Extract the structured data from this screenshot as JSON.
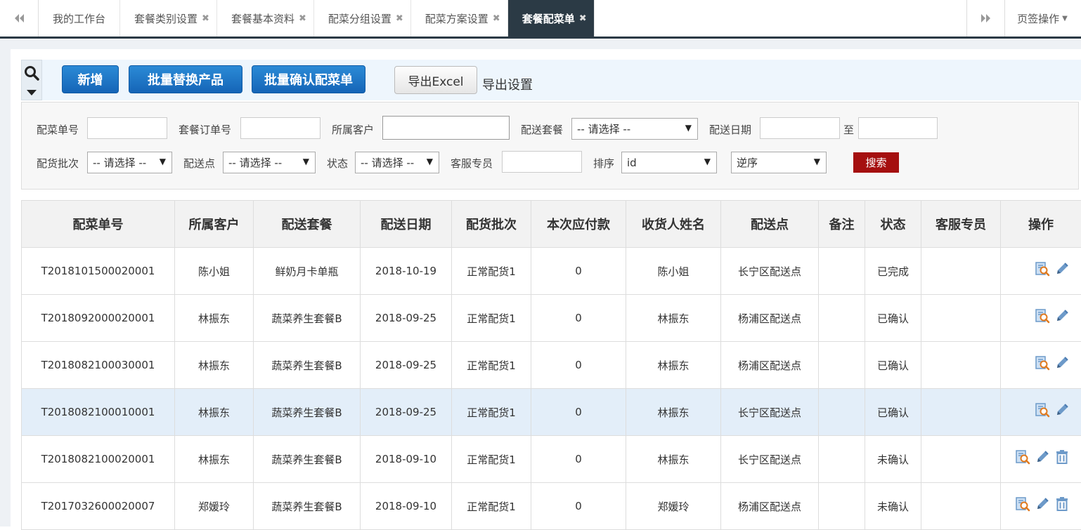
{
  "tabs": {
    "items": [
      {
        "label": "我的工作台",
        "closable": false,
        "active": false
      },
      {
        "label": "套餐类别设置",
        "closable": true,
        "active": false
      },
      {
        "label": "套餐基本资料",
        "closable": true,
        "active": false
      },
      {
        "label": "配菜分组设置",
        "closable": true,
        "active": false
      },
      {
        "label": "配菜方案设置",
        "closable": true,
        "active": false
      },
      {
        "label": "套餐配菜单",
        "closable": true,
        "active": true
      }
    ],
    "page_ops_label": "页签操作"
  },
  "toolbar": {
    "add_label": "新增",
    "batch_replace_label": "批量替换产品",
    "batch_confirm_label": "批量确认配菜单",
    "export_label": "导出Excel",
    "export_settings_label": "导出设置"
  },
  "filters": {
    "order_no_label": "配菜单号",
    "package_order_label": "套餐订单号",
    "customer_label": "所属客户",
    "package_label": "配送套餐",
    "package_value": "-- 请选择 --",
    "date_label": "配送日期",
    "date_to_label": "至",
    "batch_label": "配货批次",
    "batch_value": "-- 请选择 --",
    "point_label": "配送点",
    "point_value": "-- 请选择 --",
    "status_label": "状态",
    "status_value": "-- 请选择 --",
    "service_label": "客服专员",
    "sort_label": "排序",
    "sort_field_value": "id",
    "sort_order_value": "逆序",
    "search_label": "搜索"
  },
  "table": {
    "headers": [
      "配菜单号",
      "所属客户",
      "配送套餐",
      "配送日期",
      "配货批次",
      "本次应付款",
      "收货人姓名",
      "配送点",
      "备注",
      "状态",
      "客服专员",
      "操作"
    ],
    "rows": [
      {
        "no": "T2018101500020001",
        "customer": "陈小姐",
        "package": "鲜奶月卡单瓶",
        "date": "2018-10-19",
        "batch": "正常配货1",
        "pay": "0",
        "receiver": "陈小姐",
        "point": "长宁区配送点",
        "note": "",
        "status": "已完成",
        "service": "",
        "ops": [
          "view-icon",
          "edit-icon"
        ]
      },
      {
        "no": "T2018092000020001",
        "customer": "林振东",
        "package": "蔬菜养生套餐B",
        "date": "2018-09-25",
        "batch": "正常配货1",
        "pay": "0",
        "receiver": "林振东",
        "point": "杨浦区配送点",
        "note": "",
        "status": "已确认",
        "service": "",
        "ops": [
          "view-icon",
          "edit-icon"
        ]
      },
      {
        "no": "T2018082100030001",
        "customer": "林振东",
        "package": "蔬菜养生套餐B",
        "date": "2018-09-25",
        "batch": "正常配货1",
        "pay": "0",
        "receiver": "林振东",
        "point": "杨浦区配送点",
        "note": "",
        "status": "已确认",
        "service": "",
        "ops": [
          "view-icon",
          "edit-icon"
        ]
      },
      {
        "no": "T2018082100010001",
        "customer": "林振东",
        "package": "蔬菜养生套餐B",
        "date": "2018-09-25",
        "batch": "正常配货1",
        "pay": "0",
        "receiver": "林振东",
        "point": "长宁区配送点",
        "note": "",
        "status": "已确认",
        "service": "",
        "ops": [
          "view-icon",
          "edit-icon"
        ],
        "highlight": true
      },
      {
        "no": "T2018082100020001",
        "customer": "林振东",
        "package": "蔬菜养生套餐B",
        "date": "2018-09-10",
        "batch": "正常配货1",
        "pay": "0",
        "receiver": "林振东",
        "point": "长宁区配送点",
        "note": "",
        "status": "未确认",
        "service": "",
        "ops": [
          "view-icon",
          "edit-icon",
          "delete-icon"
        ]
      },
      {
        "no": "T2017032600020007",
        "customer": "郑媛玲",
        "package": "蔬菜养生套餐B",
        "date": "2018-09-10",
        "batch": "正常配货1",
        "pay": "0",
        "receiver": "郑媛玲",
        "point": "杨浦区配送点",
        "note": "",
        "status": "未确认",
        "service": "",
        "ops": [
          "view-icon",
          "edit-icon",
          "delete-icon"
        ]
      }
    ]
  },
  "colors": {
    "active_tab": "#2b3a45",
    "primary_button": "#1a73c8",
    "search_button": "#a50f0f",
    "row_highlight": "#e3eef9"
  }
}
